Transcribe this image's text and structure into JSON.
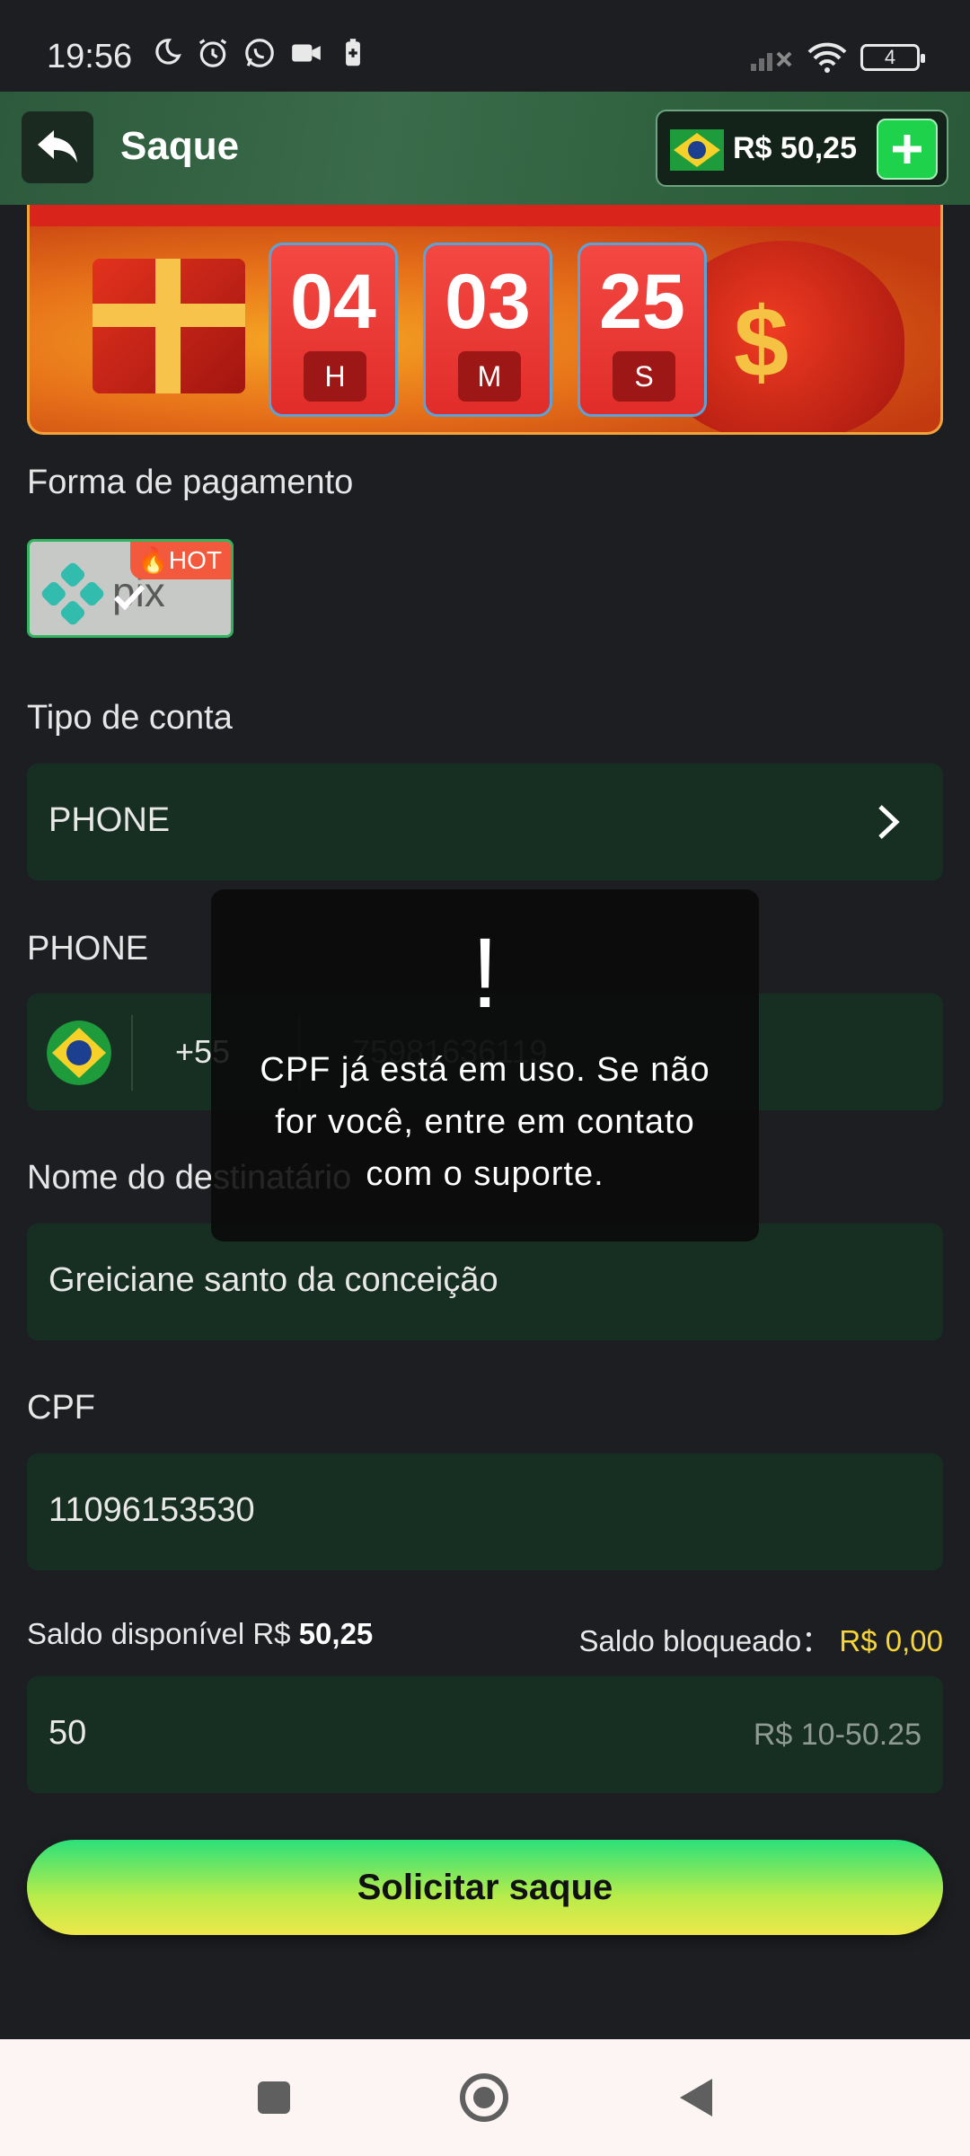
{
  "status_bar": {
    "time": "19:56",
    "battery": "4",
    "icons": [
      "moon-icon",
      "alarm-icon",
      "whatsapp-icon",
      "video-icon",
      "battery-saver-icon",
      "signal-icon",
      "wifi-icon"
    ]
  },
  "header": {
    "title": "Saque",
    "balance": "R$ 50,25"
  },
  "banner": {
    "timer": [
      {
        "value": "04",
        "unit": "H"
      },
      {
        "value": "03",
        "unit": "M"
      },
      {
        "value": "25",
        "unit": "S"
      }
    ]
  },
  "payment": {
    "label": "Forma de pagamento",
    "method": "pix",
    "hot_tag": "HOT"
  },
  "account_type": {
    "label": "Tipo de conta",
    "value": "PHONE"
  },
  "phone": {
    "label": "PHONE",
    "country_code": "+55",
    "number": "75981636119"
  },
  "recipient": {
    "label": "Nome do destinatário",
    "value": "Greiciane santo da conceição"
  },
  "cpf": {
    "label": "CPF",
    "value": "11096153530"
  },
  "saldo": {
    "available_label": "Saldo disponível R$",
    "available_value": "50,25",
    "blocked_label": "Saldo bloqueado：",
    "blocked_value": "R$ 0,00"
  },
  "amount": {
    "value": "50",
    "hint": "R$ 10-50.25"
  },
  "submit": {
    "label": "Solicitar saque"
  },
  "toast": {
    "icon": "!",
    "message": "CPF já está em uso. Se não for você, entre em contato com o suporte."
  },
  "colors": {
    "background": "#1d1e22",
    "field": "#172e22",
    "header": "#2d5a3c",
    "accent_green": "#1ed24b",
    "accent_yellow": "#f6d63a"
  }
}
